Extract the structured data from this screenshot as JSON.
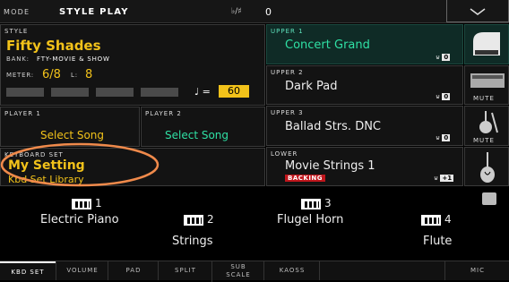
{
  "header": {
    "mode_label": "MODE",
    "mode_value": "STYLE PLAY",
    "transpose_label": "♭/♯",
    "transpose_value": "0"
  },
  "style": {
    "label": "STYLE",
    "name": "Fifty Shades",
    "bank_label": "BANK:",
    "bank": "FTY-MOVIE & SHOW",
    "meter_label": "METER:",
    "meter": "6/8",
    "length_label": "L:",
    "length": "8",
    "tempo_note": "♩ =",
    "tempo": "60"
  },
  "player1": {
    "label": "PLAYER 1",
    "value": "Select Song"
  },
  "player2": {
    "label": "PLAYER 2",
    "value": "Select Song"
  },
  "kbdset": {
    "label": "KEYBOARD SET",
    "name": "My Setting",
    "library": "Kbd Set Library"
  },
  "upper1": {
    "label": "UPPER 1",
    "name": "Concert Grand",
    "oct": "0"
  },
  "upper2": {
    "label": "UPPER 2",
    "name": "Dark Pad",
    "oct": "0",
    "mute": "MUTE"
  },
  "upper3": {
    "label": "UPPER 3",
    "name": "Ballad Strs. DNC",
    "oct": "0",
    "mute": "MUTE"
  },
  "lower": {
    "label": "LOWER",
    "name": "Movie Strings 1",
    "badge": "BACKING",
    "oct": "+1"
  },
  "pads": [
    {
      "num": "1",
      "name": "Electric Piano"
    },
    {
      "num": "2",
      "name": "Strings"
    },
    {
      "num": "3",
      "name": "Flugel Horn"
    },
    {
      "num": "4",
      "name": "Flute"
    }
  ],
  "tabs": [
    "KBD SET",
    "VOLUME",
    "PAD",
    "SPLIT",
    "SUB SCALE",
    "KAOSS",
    "",
    "MIC"
  ],
  "colors": {
    "accent_yellow": "#f2c21a",
    "upper_green": "#2fe0a4",
    "highlight_orange": "#f08a4b"
  }
}
